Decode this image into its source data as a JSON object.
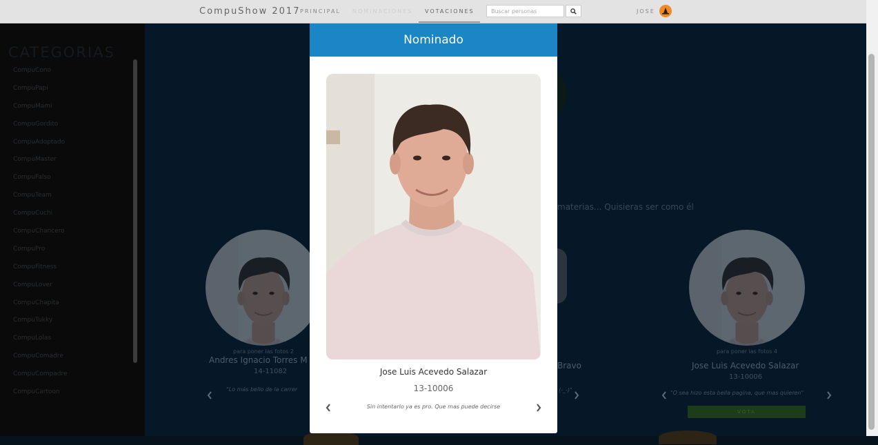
{
  "navbar": {
    "brand": "CompuShow 2017",
    "links": [
      "PRINCIPAL",
      "NOMINACIONES",
      "VOTACIONES"
    ],
    "search_placeholder": "Buscar personas",
    "user": "JOSE"
  },
  "sidebar": {
    "title": "CATEGORIAS",
    "items": [
      "CompuCono",
      "CompuPapi",
      "CompuMami",
      "CompuGordito",
      "CompuAdoptado",
      "CompuMaster",
      "CompuFalso",
      "CompuTeam",
      "CompuCuchi",
      "CompuChancero",
      "CompuPro",
      "CompuFitness",
      "CompuLover",
      "CompuChapita",
      "CompuTukky",
      "CompuLolas",
      "CompuComadre",
      "CompuCompadre",
      "CompuCartoon"
    ]
  },
  "background": {
    "fragment_paren": ")",
    "fragment_text": "materias... Quisieras ser como él",
    "cards": [
      {
        "caption": "para poner las fotos 2",
        "name": "Andres Ignacio Torres M",
        "carne": "14-11082",
        "quote": "\"Lo más bello de la carrer"
      },
      {
        "name_fragment": "Bravo",
        "quote_fragment": "(-_-)\""
      },
      {
        "caption": "para poner las fotos 4",
        "name": "Jose Luis Acevedo Salazar",
        "carne": "13-10006",
        "quote": "\"O sea hizo esta bella pagina, que mas quieren\""
      }
    ],
    "vote_label": "VOTA"
  },
  "modal": {
    "title": "Nominado",
    "name": "Jose Luis Acevedo Salazar",
    "carne": "13-10006",
    "quote": "Sin intentarlo ya es pro. Que mas puede decirse"
  },
  "icons": {
    "search": "search-icon",
    "user": "witch-hat-icon",
    "prev": "chevron-left-icon",
    "next": "chevron-right-icon"
  },
  "colors": {
    "modal_header": "#1a86c5",
    "navbar": "#e3e3e3",
    "vote_button": "#1c3c1a",
    "avatar": "#f08a24"
  }
}
